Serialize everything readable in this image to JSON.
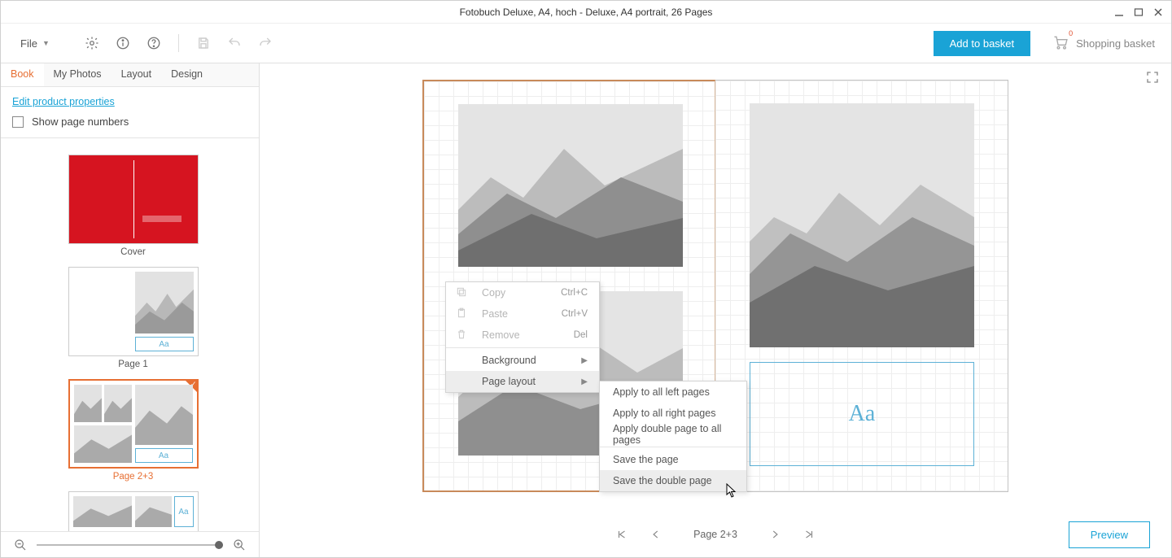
{
  "window": {
    "title": "Fotobuch Deluxe, A4, hoch - Deluxe, A4 portrait, 26 Pages"
  },
  "toolbar": {
    "file_label": "File",
    "add_to_basket": "Add to basket",
    "shopping_basket": "Shopping basket",
    "basket_count": "0"
  },
  "sidebar": {
    "tabs": {
      "book": "Book",
      "my_photos": "My Photos",
      "layout": "Layout",
      "design": "Design"
    },
    "edit_link": "Edit product properties",
    "show_page_numbers": "Show page numbers",
    "thumbs": {
      "cover": "Cover",
      "page1": "Page 1",
      "page23": "Page 2+3"
    },
    "aa": "Aa"
  },
  "canvas": {
    "text_placeholder": "Aa"
  },
  "context_menu": {
    "copy": "Copy",
    "copy_sc": "Ctrl+C",
    "paste": "Paste",
    "paste_sc": "Ctrl+V",
    "remove": "Remove",
    "remove_sc": "Del",
    "background": "Background",
    "page_layout": "Page layout"
  },
  "submenu": {
    "apply_left": "Apply to all left pages",
    "apply_right": "Apply to all right pages",
    "apply_double_all": "Apply double page to all pages",
    "save_page": "Save the page",
    "save_double": "Save the double page"
  },
  "page_nav": {
    "label": "Page 2+3",
    "preview": "Preview"
  }
}
